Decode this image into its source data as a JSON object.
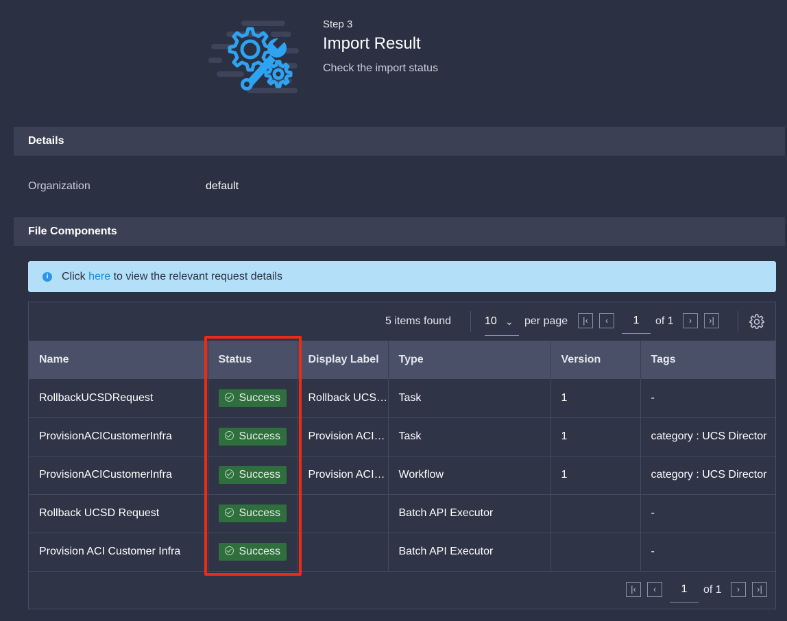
{
  "header": {
    "step": "Step 3",
    "title": "Import Result",
    "subtitle": "Check the import status"
  },
  "details": {
    "section_title": "Details",
    "organization_label": "Organization",
    "organization_value": "default"
  },
  "file_components": {
    "section_title": "File Components",
    "banner": {
      "prefix": "Click",
      "link": "here",
      "suffix": "to view the relevant request details"
    }
  },
  "grid": {
    "items_found": "5 items found",
    "per_page_value": "10",
    "per_page_label": "per page",
    "page_value": "1",
    "page_of": "of 1",
    "columns": [
      "Name",
      "Status",
      "Display Label",
      "Type",
      "Version",
      "Tags"
    ],
    "rows": [
      {
        "name": "RollbackUCSDRequest",
        "status": "Success",
        "display_label": "Rollback UCSD Request",
        "type": "Task",
        "version": "1",
        "tags": "-"
      },
      {
        "name": "ProvisionACICustomerInfra",
        "status": "Success",
        "display_label": "Provision ACI Customer Infra",
        "type": "Task",
        "version": "1",
        "tags": "category : UCS Director"
      },
      {
        "name": "ProvisionACICustomerInfra",
        "status": "Success",
        "display_label": "Provision ACI Customer Infra",
        "type": "Workflow",
        "version": "1",
        "tags": "category : UCS Director"
      },
      {
        "name": "Rollback UCSD Request",
        "status": "Success",
        "display_label": "",
        "type": "Batch API Executor",
        "version": "",
        "tags": "-"
      },
      {
        "name": "Provision ACI Customer Infra",
        "status": "Success",
        "display_label": "",
        "type": "Batch API Executor",
        "version": "",
        "tags": "-"
      }
    ],
    "footer_page_value": "1",
    "footer_page_of": "of 1"
  },
  "colors": {
    "background": "#2b3042",
    "section_bar": "#3b4054",
    "banner": "#b3dff8",
    "success_badge": "#2f6e3d",
    "highlight": "#ef2a14",
    "accent_blue": "#2b96e8"
  }
}
